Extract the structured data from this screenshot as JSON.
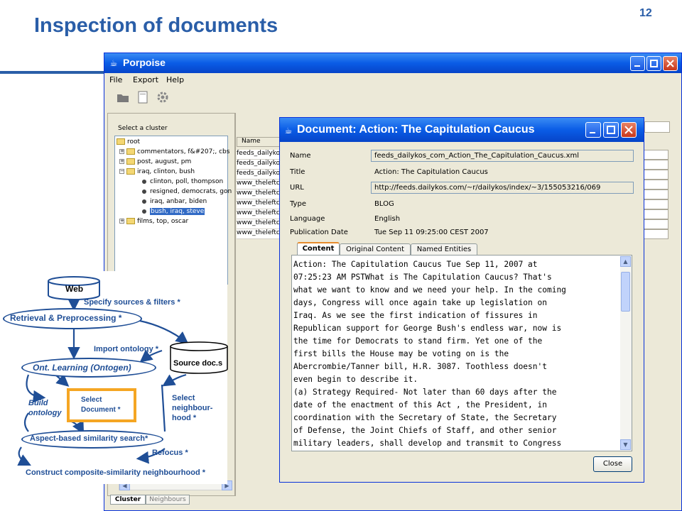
{
  "slide": {
    "title": "Inspection of documents",
    "page_number": "12"
  },
  "app": {
    "title": "Porpoise",
    "menu": [
      "File",
      "Export",
      "Help"
    ]
  },
  "cluster_pane": {
    "label": "Select a cluster",
    "tree": [
      {
        "text": "root"
      },
      {
        "text": "commentators, f&#207;, cbs"
      },
      {
        "text": "post, august, pm"
      },
      {
        "text": "iraq, clinton, bush"
      },
      {
        "text": "clinton, poll, thompson"
      },
      {
        "text": "resigned, democrats, gon"
      },
      {
        "text": "iraq, anbar, biden"
      },
      {
        "text": "bush, iraq, steve"
      },
      {
        "text": "films, top, oscar"
      }
    ],
    "tabs": [
      "Cluster",
      "Neighbours"
    ]
  },
  "doc_list": {
    "header": "Name",
    "rows": [
      "feeds_dailyko",
      "feeds_dailyko",
      "feeds_dailyko",
      "www_theleftc",
      "www_theleftc",
      "www_theleftc",
      "www_theleftc",
      "www_theleftc",
      "www_theleftc"
    ]
  },
  "document": {
    "title": "Document: Action:  The Capitulation Caucus",
    "fields": {
      "name_label": "Name",
      "name_value": "feeds_dailykos_com_Action_The_Capitulation_Caucus.xml",
      "title_label": "Title",
      "title_value": "Action:  The Capitulation Caucus",
      "url_label": "URL",
      "url_value": "http://feeds.dailykos.com/~r/dailykos/index/~3/155053216/069",
      "type_label": "Type",
      "type_value": "BLOG",
      "language_label": "Language",
      "language_value": "English",
      "date_label": "Publication Date",
      "date_value": "Tue Sep 11 09:25:00 CEST 2007"
    },
    "tabs": [
      "Content",
      "Original Content",
      "Named Entities"
    ],
    "content_lines": [
      "Action: The Capitulation Caucus Tue Sep 11, 2007 at",
      "07:25:23 AM PSTWhat is The Capitulation Caucus? That's",
      "what we want to know and we need your help. In the coming",
      "days, Congress will once again take up legislation on",
      "Iraq. As we see the first indication of fissures in",
      "Republican support for George Bush's endless war, now is",
      "the time for Democrats to stand firm. Yet one of the",
      "first bills the House may be voting on is the",
      "Abercrombie/Tanner bill, H.R. 3087. Toothless doesn't",
      "even begin to describe it.",
      "(a) Strategy Required- Not later than 60 days after the",
      "date of the enactment of this Act , the President, in",
      "coordination with the Secretary of State, the Secretary",
      "of Defense, the Joint Chiefs of Staff, and other senior",
      "military leaders, shall develop and transmit to Congress"
    ],
    "close_label": "Close"
  },
  "diagram": {
    "web": "Web",
    "specify": "Specify sources & filters *",
    "retrieval": "Retrieval & Preprocessing *",
    "import": "Import ontology *",
    "source_docs": "Source doc.s",
    "ont_learning": "Ont. Learning (Ontogen)",
    "build": "Build",
    "ontology": "ontology",
    "select_doc_1": "Select",
    "select_doc_2": "Document *",
    "select_nb_1": "Select",
    "select_nb_2": "neighbour-",
    "select_nb_3": "hood *",
    "aspect": "Aspect-based similarity search*",
    "refocus": "Refocus *",
    "construct": "Construct composite-similarity neighbourhood *"
  },
  "colors": {
    "slide_blue": "#2a5ea8",
    "diagram_blue": "#1f4e96",
    "highlight_orange": "#f5a623"
  }
}
